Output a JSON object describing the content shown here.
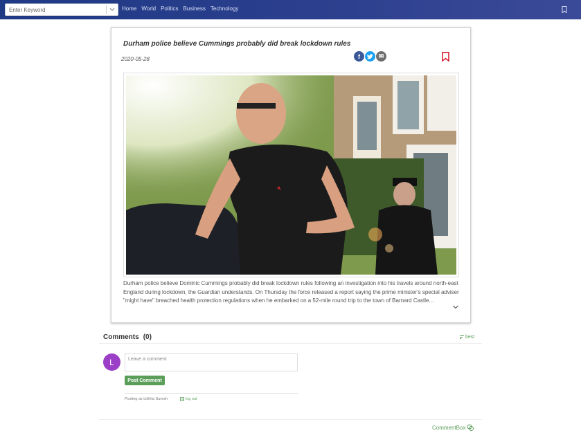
{
  "header": {
    "search": {
      "placeholder": "Enter Keyword"
    },
    "nav": [
      "Home",
      "World",
      "Politics",
      "Business",
      "Technology"
    ]
  },
  "article": {
    "title": "Durham police believe Cummings probably did break lockdown rules",
    "date": "2020-05-28",
    "share": {
      "facebook": "f",
      "twitter": "t",
      "email": "✉"
    },
    "body": "Durham police believe Dominic Cummings probably did break lockdown rules following an investigation into his travels around north-east England during lockdown, the Guardian understands. On Thursday the force released a report saying the prime minister's special adviser \"might have\" breached health protection regulations when he embarked on a 52-mile round trip to the town of Barnard Castle..."
  },
  "comments": {
    "heading": "Comments",
    "count": "(0)",
    "sort_label": "best",
    "avatar_letter": "L",
    "input_placeholder": "Leave a comment",
    "post_label": "Post Comment",
    "posting_as": "Posting as Likhita Suresh",
    "logout_label": "log out",
    "brand": "CommentBox"
  },
  "colors": {
    "header": "#2b3f8e",
    "accent_green": "#5a9e5a",
    "avatar": "#9c3fc7",
    "bookmark": "#d0021b"
  }
}
